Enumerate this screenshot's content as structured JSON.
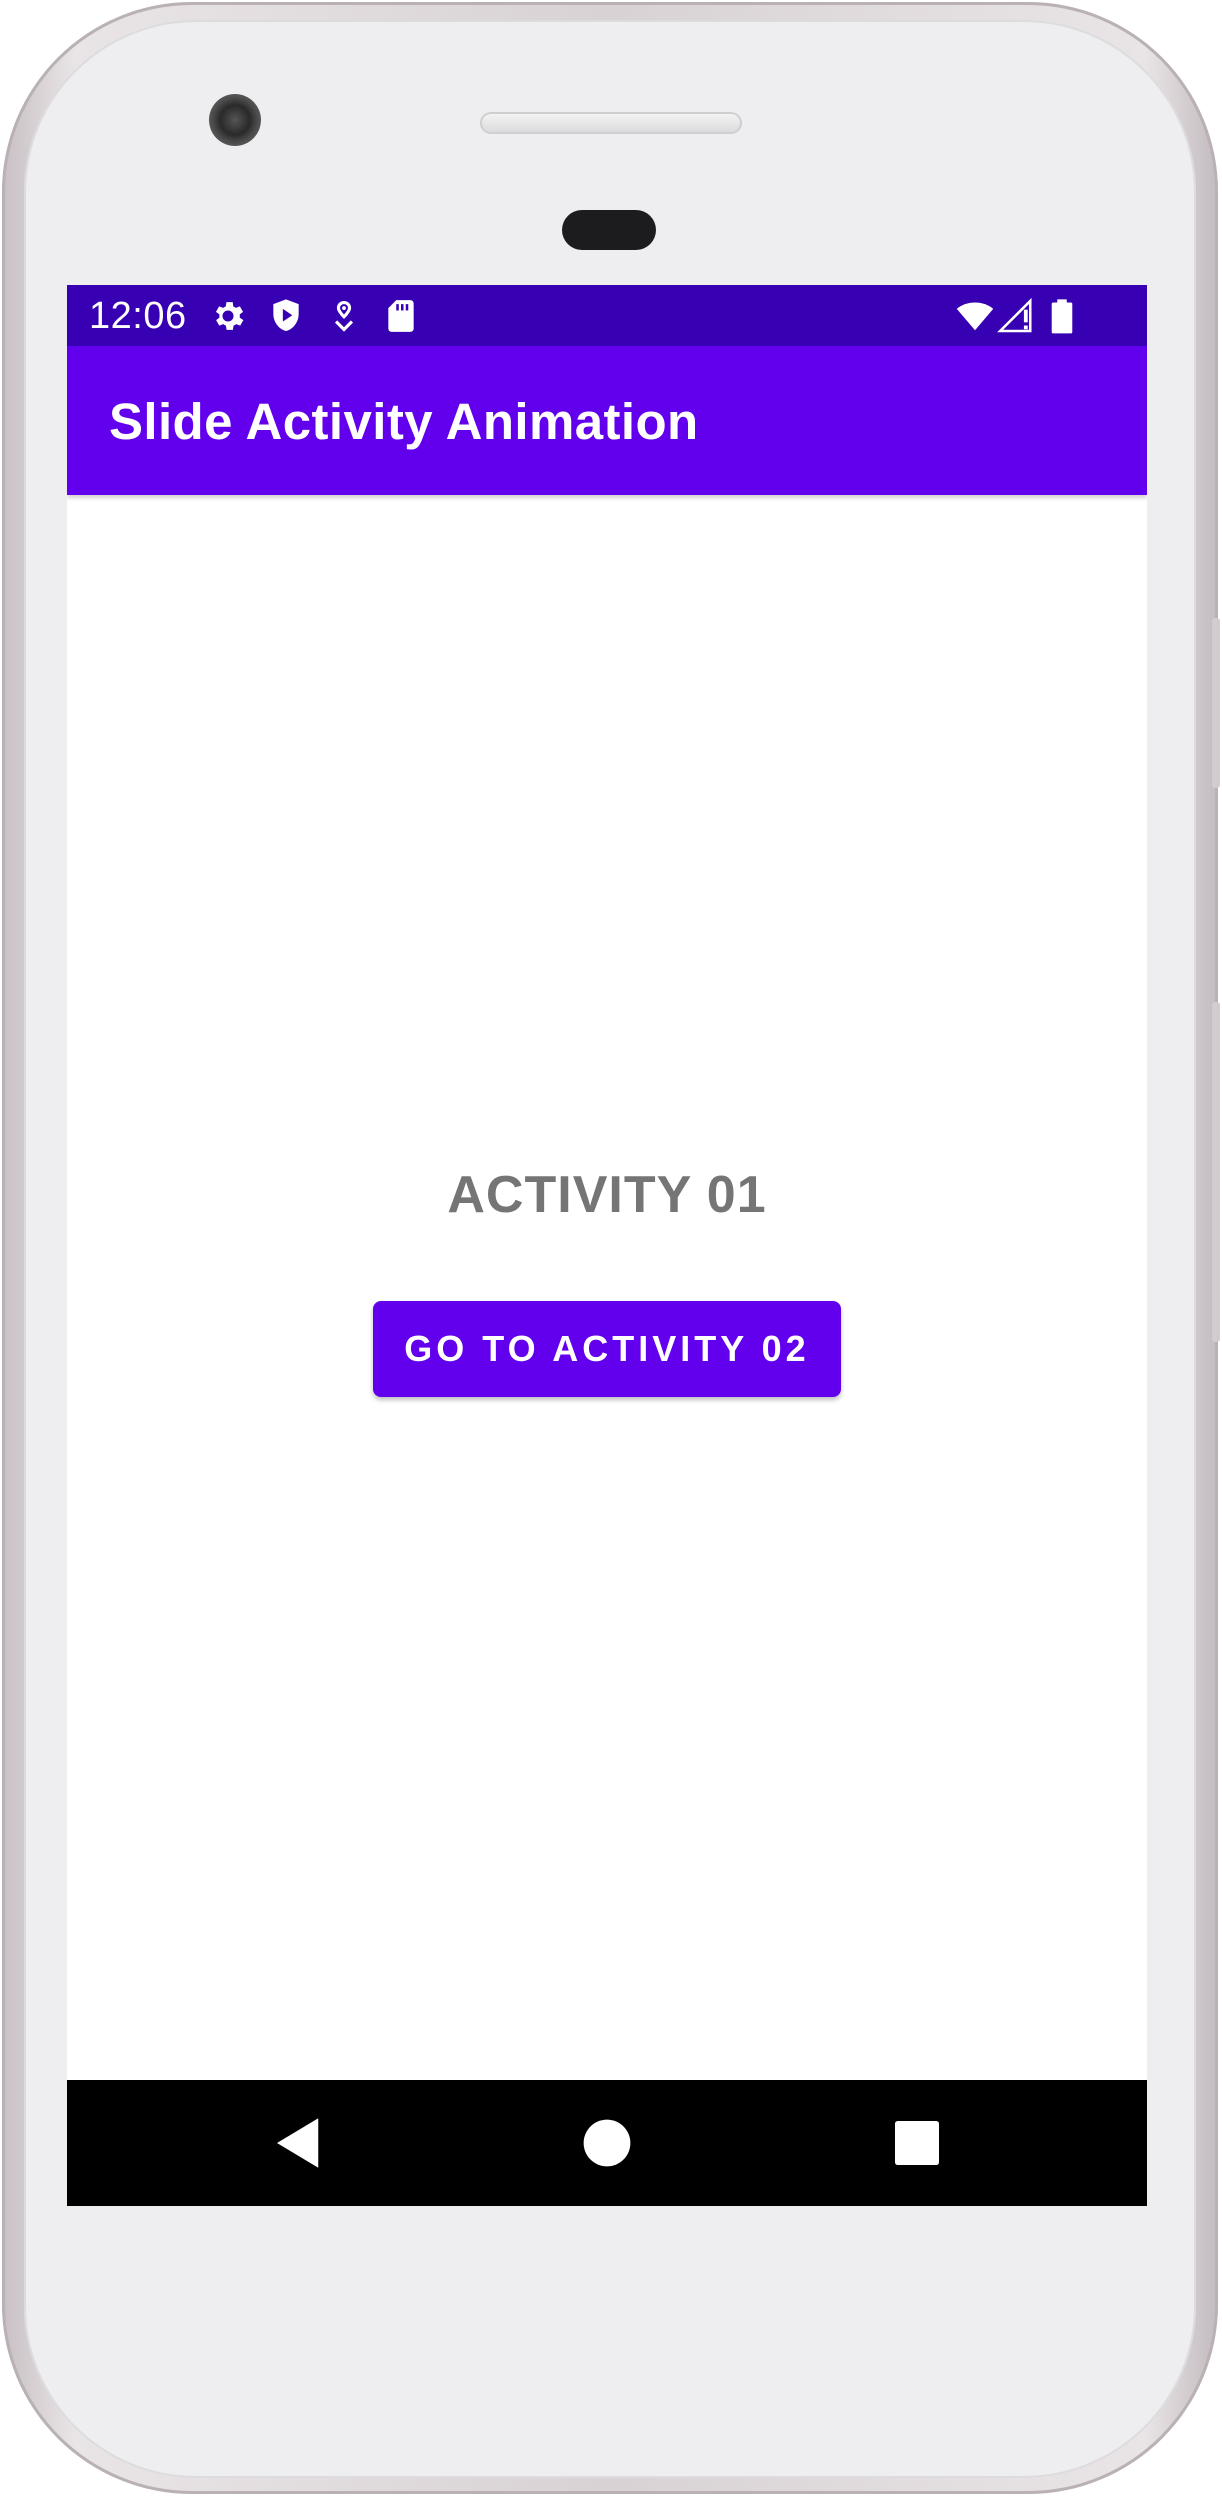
{
  "status_bar": {
    "time": "12:06",
    "left_icons": [
      "gear-icon",
      "shield-play-icon",
      "location-icon",
      "sd-card-icon"
    ],
    "right_icons": [
      "wifi-icon",
      "signal-icon",
      "battery-icon"
    ]
  },
  "app_bar": {
    "title": "Slide Activity Animation"
  },
  "main": {
    "activity_label": "ACTIVITY 01",
    "button_label": "GO TO ACTIVITY 02"
  },
  "nav_bar": {
    "buttons": [
      "back-icon",
      "home-icon",
      "recents-icon"
    ]
  },
  "colors": {
    "status_bar": "#3700b3",
    "primary": "#6200ee",
    "label_text": "#757575",
    "nav_bar": "#000000"
  }
}
